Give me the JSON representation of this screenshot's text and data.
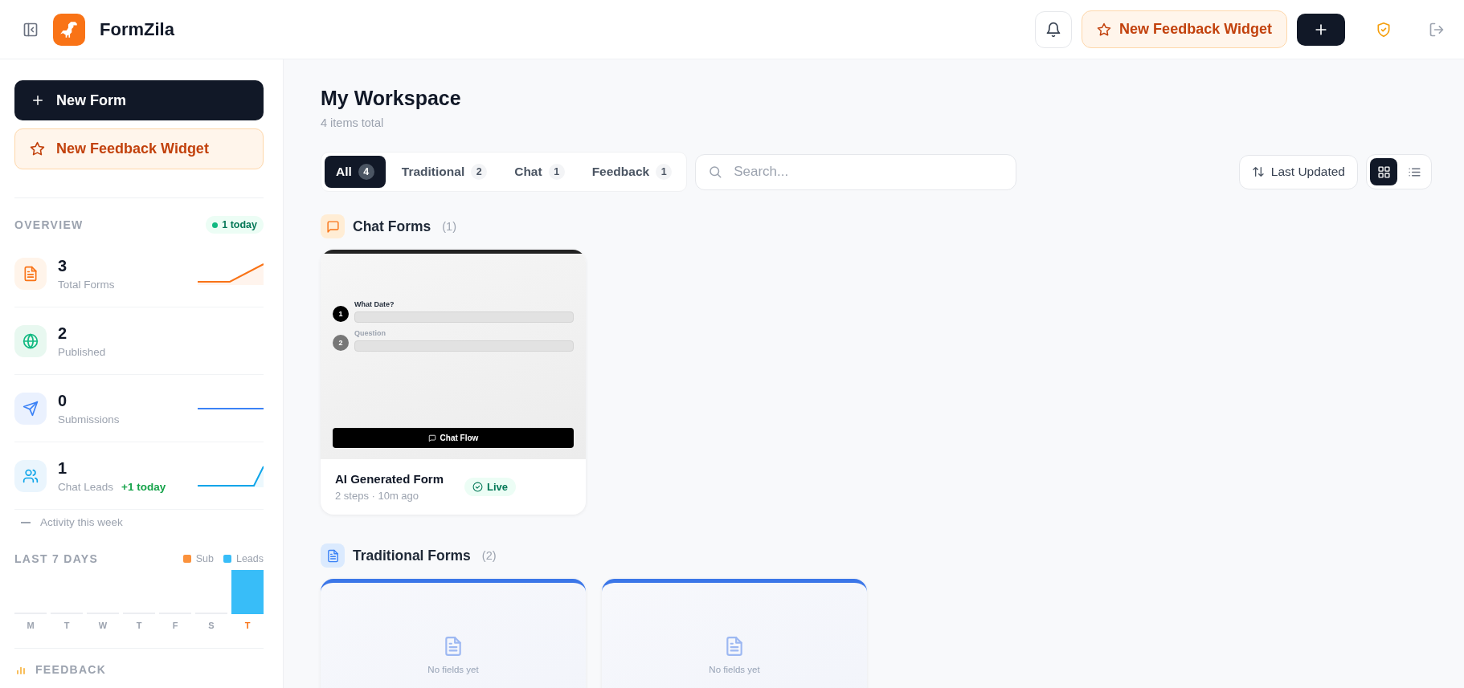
{
  "app": {
    "name": "FormZila"
  },
  "header": {
    "feedback_button": "New Feedback Widget"
  },
  "sidebar": {
    "new_form": "New Form",
    "new_feedback": "New Feedback Widget",
    "overview": {
      "title": "OVERVIEW",
      "badge": "1 today"
    },
    "stats": [
      {
        "kind": "forms",
        "value": "3",
        "label": "Total Forms"
      },
      {
        "kind": "published",
        "value": "2",
        "label": "Published"
      },
      {
        "kind": "submissions",
        "value": "0",
        "label": "Submissions"
      },
      {
        "kind": "leads",
        "value": "1",
        "label": "Chat Leads",
        "note": "+1 today"
      }
    ],
    "activity": "Activity this week",
    "last7": {
      "title": "LAST 7 DAYS",
      "legend": [
        {
          "label": "Sub",
          "color": "#fb923c"
        },
        {
          "label": "Leads",
          "color": "#38bdf8"
        }
      ],
      "days": [
        {
          "label": "M",
          "today": false
        },
        {
          "label": "T",
          "today": false
        },
        {
          "label": "W",
          "today": false
        },
        {
          "label": "T",
          "today": false
        },
        {
          "label": "F",
          "today": false
        },
        {
          "label": "S",
          "today": false
        },
        {
          "label": "T",
          "today": true
        }
      ]
    },
    "feedback": "FEEDBACK"
  },
  "main": {
    "title": "My Workspace",
    "subtitle": "4 items total",
    "tabs": [
      {
        "label": "All",
        "count": "4",
        "selected": true
      },
      {
        "label": "Traditional",
        "count": "2",
        "selected": false
      },
      {
        "label": "Chat",
        "count": "1",
        "selected": false
      },
      {
        "label": "Feedback",
        "count": "1",
        "selected": false
      }
    ],
    "search": {
      "placeholder": "Search..."
    },
    "sort": "Last Updated",
    "views": [
      {
        "kind": "grid",
        "selected": true
      },
      {
        "kind": "list",
        "selected": false
      }
    ],
    "sections": [
      {
        "kind": "chat",
        "title": "Chat Forms",
        "count": "(1)",
        "cards": [
          {
            "steps": [
              {
                "number": "1",
                "label": "What Date?",
                "active": true
              },
              {
                "number": "2",
                "label": "Question",
                "active": false
              }
            ],
            "button": "Chat Flow",
            "title": "AI Generated Form",
            "meta": "2 steps · 10m ago",
            "status": "Live"
          }
        ]
      },
      {
        "kind": "traditional",
        "title": "Traditional Forms",
        "count": "(2)",
        "cards": [
          {
            "empty": "No fields yet"
          },
          {
            "empty": "No fields yet"
          }
        ]
      }
    ]
  }
}
